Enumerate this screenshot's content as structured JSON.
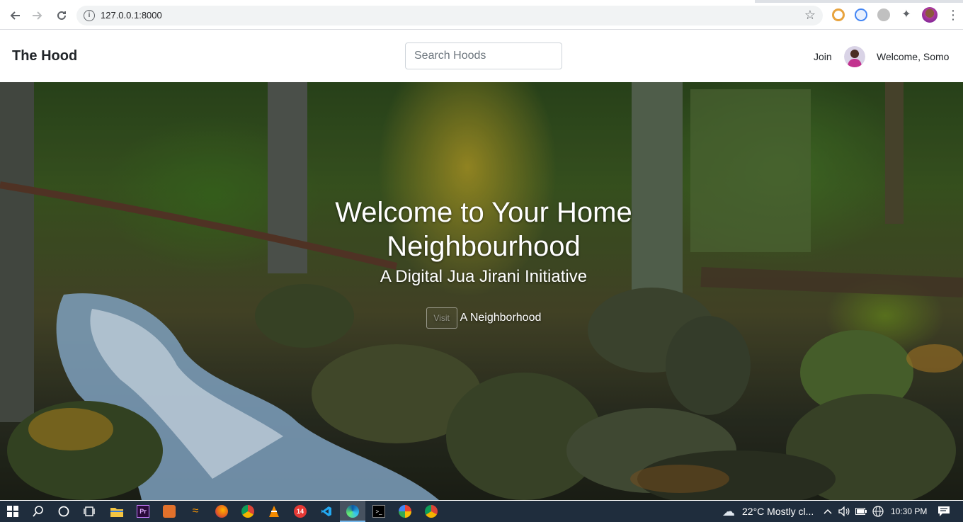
{
  "browser": {
    "url": "127.0.0.1:8000",
    "back_icon": "back-arrow-icon",
    "forward_icon": "forward-arrow-icon",
    "reload_icon": "reload-icon"
  },
  "navbar": {
    "brand": "The Hood",
    "search_placeholder": "Search Hoods",
    "join_label": "Join",
    "welcome": "Welcome, Somo"
  },
  "hero": {
    "title": "Welcome to Your Home Neighbourhood",
    "subtitle": "A Digital Jua Jirani Initiative",
    "visit_label": "Visit",
    "cta_text": "A Neighborhood"
  },
  "taskbar": {
    "weather": "22°C  Mostly cl...",
    "time": "10:30 PM",
    "badge": "14"
  },
  "colors": {
    "taskbar_bg": "#1f2d3d",
    "brand_text": "#212529"
  }
}
